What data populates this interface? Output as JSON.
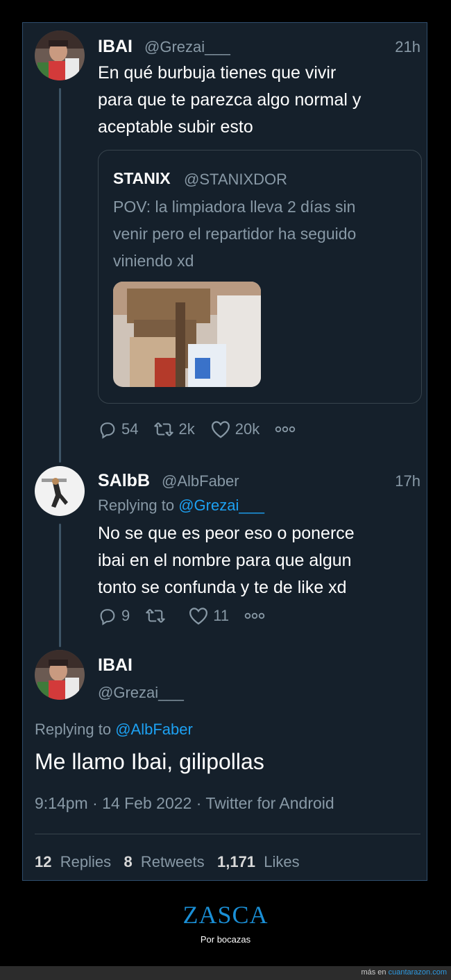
{
  "tweet1": {
    "name": "IBAI",
    "handle": "@Grezai___",
    "time": "21h",
    "text_lines": [
      "En qué burbuja tienes que vivir",
      "para que te parezca algo normal y",
      "aceptable subir esto"
    ],
    "quote": {
      "name": "STANIX",
      "handle": "@STANIXDOR",
      "text_lines": [
        "POV: la limpiadora lleva 2 días sin",
        "venir pero el repartidor ha seguido",
        "viniendo xd"
      ]
    },
    "actions": {
      "replies": "54",
      "retweets": "2k",
      "likes": "20k"
    }
  },
  "tweet2": {
    "name": "SAlbB",
    "handle": "@AlbFaber",
    "time": "17h",
    "replying_label": "Replying to",
    "replying_to": "@Grezai___",
    "text_lines": [
      "No se que es peor eso o ponerce",
      "ibai en el nombre para que algun",
      "tonto se confunda y te de like xd"
    ],
    "actions": {
      "replies": "9",
      "retweets": "",
      "likes": "11"
    }
  },
  "tweet3": {
    "name": "IBAI",
    "handle": "@Grezai___",
    "replying_label": "Replying to",
    "replying_to": "@AlbFaber",
    "text": "Me llamo Ibai, gilipollas",
    "meta": "9:14pm · 14 Feb 2022 · Twitter for Android",
    "stats": {
      "replies_count": "12",
      "replies_label": "Replies",
      "retweets_count": "8",
      "retweets_label": "Retweets",
      "likes_count": "1,171",
      "likes_label": "Likes"
    }
  },
  "footer": {
    "title": "ZASCA",
    "subtitle": "Por bocazas",
    "credit_prefix": "más en",
    "credit_site": "cuantarazon.com"
  },
  "icons": {
    "reply": "reply-icon",
    "retweet": "retweet-icon",
    "like": "heart-icon",
    "more": "more-icon"
  },
  "colors": {
    "background": "#15202b",
    "accent": "#1da1f2",
    "muted": "#8899a6"
  }
}
